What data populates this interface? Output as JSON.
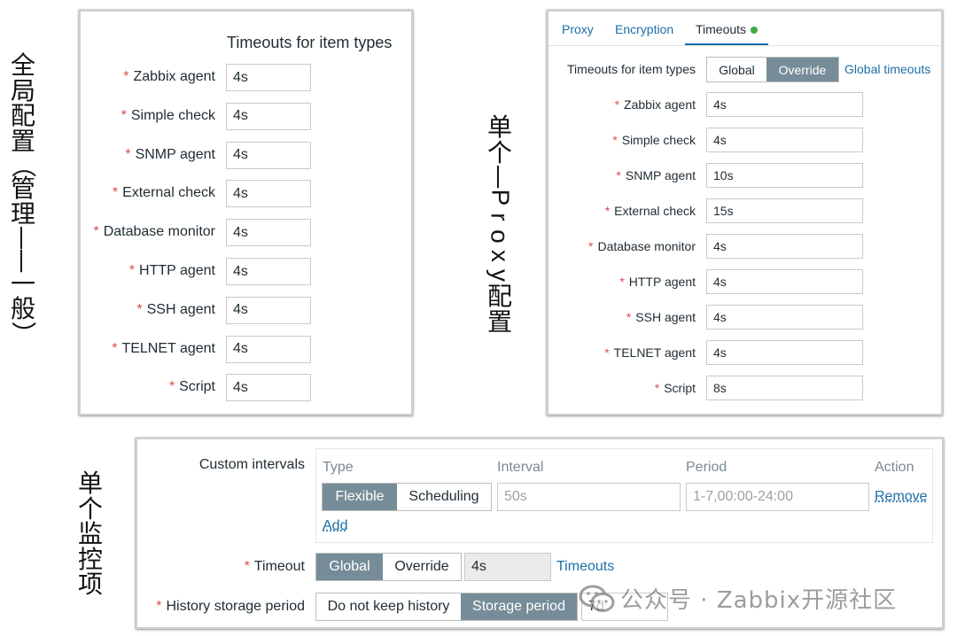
{
  "side_labels": {
    "global": [
      "全",
      "局",
      "配",
      "置",
      "（",
      "管",
      "理",
      "—",
      "—",
      "一",
      "般",
      "）"
    ],
    "proxy": [
      "单",
      "个",
      "—",
      "P",
      "r",
      "o",
      "x",
      "y",
      "配",
      "置"
    ],
    "item": [
      "单",
      "个",
      "监",
      "控",
      "项"
    ]
  },
  "global_panel": {
    "header": "Timeouts for item types",
    "rows": [
      {
        "label": "Zabbix agent",
        "value": "4s"
      },
      {
        "label": "Simple check",
        "value": "4s"
      },
      {
        "label": "SNMP agent",
        "value": "4s"
      },
      {
        "label": "External check",
        "value": "4s"
      },
      {
        "label": "Database monitor",
        "value": "4s"
      },
      {
        "label": "HTTP agent",
        "value": "4s"
      },
      {
        "label": "SSH agent",
        "value": "4s"
      },
      {
        "label": "TELNET agent",
        "value": "4s"
      },
      {
        "label": "Script",
        "value": "4s"
      }
    ]
  },
  "proxy_panel": {
    "tabs": [
      "Proxy",
      "Encryption",
      "Timeouts"
    ],
    "active_tab": "Timeouts",
    "timeouts_label": "Timeouts for item types",
    "toggle": {
      "global": "Global",
      "override": "Override",
      "selected": "Override"
    },
    "global_link": "Global timeouts",
    "rows": [
      {
        "label": "Zabbix agent",
        "value": "4s"
      },
      {
        "label": "Simple check",
        "value": "4s"
      },
      {
        "label": "SNMP agent",
        "value": "10s"
      },
      {
        "label": "External check",
        "value": "15s"
      },
      {
        "label": "Database monitor",
        "value": "4s"
      },
      {
        "label": "HTTP agent",
        "value": "4s"
      },
      {
        "label": "SSH agent",
        "value": "4s"
      },
      {
        "label": "TELNET agent",
        "value": "4s"
      },
      {
        "label": "Script",
        "value": "8s"
      }
    ],
    "colors": {
      "active_dot": "#3eaa4a",
      "tab_underline": "#1b6ea8"
    }
  },
  "item_panel": {
    "custom_intervals_label": "Custom intervals",
    "columns": {
      "type": "Type",
      "interval": "Interval",
      "period": "Period",
      "action": "Action"
    },
    "type_toggle": {
      "flexible": "Flexible",
      "scheduling": "Scheduling",
      "selected": "Flexible"
    },
    "interval_placeholder": "50s",
    "period_placeholder": "1-7,00:00-24:00",
    "remove": "Remove",
    "add": "Add",
    "timeout_label": "Timeout",
    "timeout_toggle": {
      "global": "Global",
      "override": "Override",
      "selected": "Global"
    },
    "timeout_value": "4s",
    "timeouts_link": "Timeouts",
    "history_label": "History storage period",
    "history_toggle": {
      "no_keep": "Do not keep history",
      "storage": "Storage period",
      "selected": "Storage period"
    },
    "history_value": "7d"
  },
  "watermark": {
    "text": "公众号 · Zabbix开源社区",
    "icon": "wechat-icon"
  },
  "colors": {
    "accent": "#768d99",
    "link": "#1b6ea8",
    "required": "#e04a4a"
  }
}
